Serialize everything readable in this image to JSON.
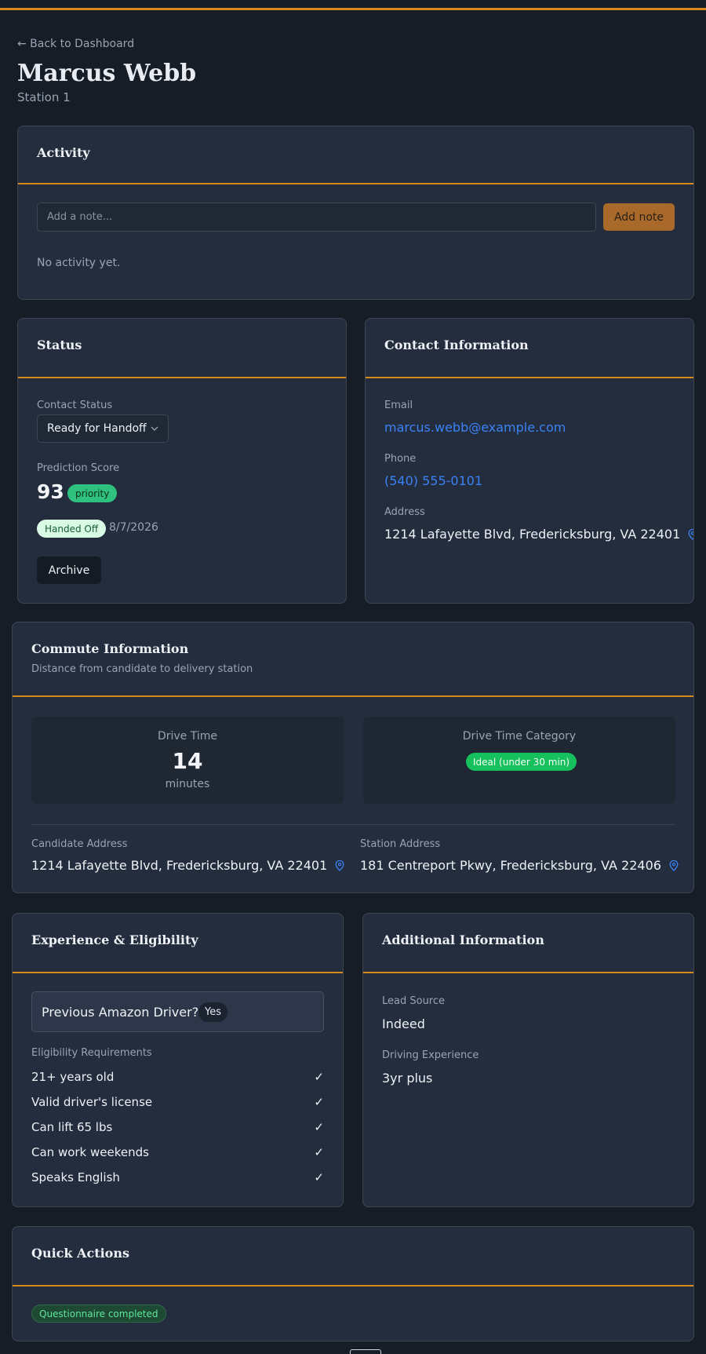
{
  "nav": {
    "back_label": "← Back to Dashboard"
  },
  "header": {
    "title": "Marcus Webb",
    "subtitle": "Station 1"
  },
  "activity": {
    "title": "Activity",
    "note_placeholder": "Add a note...",
    "add_note_label": "Add note",
    "empty_text": "No activity yet."
  },
  "status": {
    "title": "Status",
    "contact_status_label": "Contact Status",
    "contact_status_value": "Ready for Handoff",
    "prediction_label": "Prediction Score",
    "prediction_score": "93",
    "priority_badge": "priority",
    "handed_off_badge": "Handed Off",
    "handed_off_date": "8/7/2026",
    "archive_label": "Archive"
  },
  "contact": {
    "title": "Contact Information",
    "email_label": "Email",
    "email": "marcus.webb@example.com",
    "phone_label": "Phone",
    "phone": "(540) 555-0101",
    "address_label": "Address",
    "address": "1214 Lafayette Blvd, Fredericksburg, VA 22401"
  },
  "commute": {
    "title": "Commute Information",
    "description": "Distance from candidate to delivery station",
    "drive_time_label": "Drive Time",
    "drive_time_value": "14",
    "drive_time_unit": "minutes",
    "category_label": "Drive Time Category",
    "category_value": "Ideal (under 30 min)",
    "candidate_address_label": "Candidate Address",
    "candidate_address": "1214 Lafayette Blvd, Fredericksburg, VA 22401",
    "station_address_label": "Station Address",
    "station_address": "181 Centreport Pkwy, Fredericksburg, VA 22406"
  },
  "experience": {
    "title": "Experience & Eligibility",
    "prev_driver_question": "Previous Amazon Driver?",
    "prev_driver_answer": "Yes",
    "eligibility_label": "Eligibility Requirements",
    "check_glyph": "✓",
    "requirements": [
      "21+ years old",
      "Valid driver's license",
      "Can lift 65 lbs",
      "Can work weekends",
      "Speaks English"
    ]
  },
  "additional": {
    "title": "Additional Information",
    "lead_source_label": "Lead Source",
    "lead_source": "Indeed",
    "driving_experience_label": "Driving Experience",
    "driving_experience": "3yr plus"
  },
  "quick_actions": {
    "title": "Quick Actions",
    "questionnaire_badge": "Questionnaire completed"
  },
  "colors": {
    "background": "#161d27",
    "card": "#232d3d",
    "accent": "#d68a1c",
    "link": "#3b82f6",
    "success": "#16c05c"
  },
  "icons": {
    "location": "map-pin-icon",
    "dropdown": "chevron-down-icon"
  }
}
